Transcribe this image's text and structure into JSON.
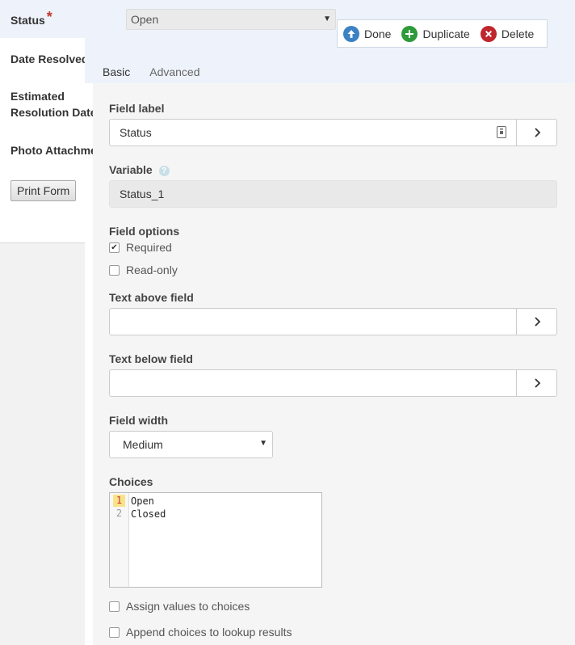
{
  "left_form": {
    "status_label": "Status",
    "required_marker": "*",
    "date_resolved_label": "Date Resolved",
    "est_res_line1": "Estimated",
    "est_res_line2": "Resolution Date",
    "photo_label": "Photo Attachment",
    "print_button": "Print Form"
  },
  "status_field": {
    "value": "Open"
  },
  "toolbar": {
    "done": "Done",
    "duplicate": "Duplicate",
    "delete": "Delete"
  },
  "tabs": [
    {
      "label": "Basic",
      "active": true
    },
    {
      "label": "Advanced",
      "active": false
    }
  ],
  "basic": {
    "field_label": {
      "label": "Field label",
      "value": "Status"
    },
    "variable": {
      "label": "Variable",
      "value": "Status_1",
      "help": "?"
    },
    "field_options": {
      "label": "Field options",
      "required": {
        "label": "Required",
        "checked": true
      },
      "readonly": {
        "label": "Read-only",
        "checked": false
      }
    },
    "text_above": {
      "label": "Text above field",
      "value": ""
    },
    "text_below": {
      "label": "Text below field",
      "value": ""
    },
    "field_width": {
      "label": "Field width",
      "value": "Medium"
    },
    "choices": {
      "label": "Choices",
      "lines": [
        {
          "num": "1",
          "text": "Open"
        },
        {
          "num": "2",
          "text": "Closed"
        }
      ]
    },
    "assign_values": {
      "label": "Assign values to choices",
      "checked": false
    },
    "append_choices": {
      "label": "Append choices to lookup results",
      "checked": false
    }
  },
  "colors": {
    "accent": "#2a9d8f",
    "done_icon": "#3b82c4",
    "duplicate_icon": "#2e9a3a",
    "delete_icon": "#c0262d",
    "required_star": "#c0392b"
  }
}
